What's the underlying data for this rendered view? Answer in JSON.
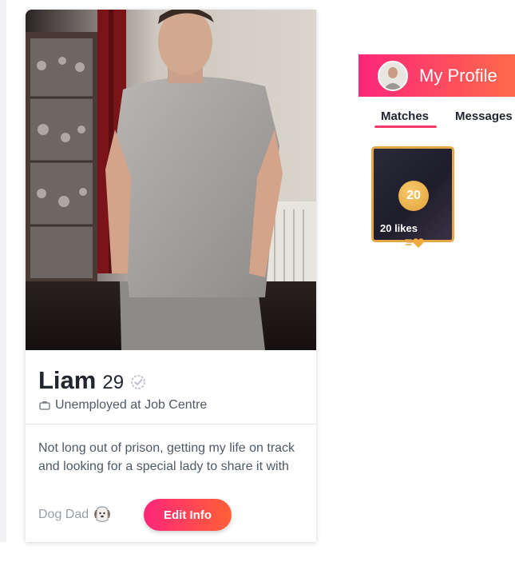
{
  "profile": {
    "name": "Liam",
    "age": "29",
    "job": "Unemployed at Job Centre",
    "bio": "Not long out of prison, getting my life on track and looking for a special lady to share it with",
    "badge": "Dog Dad",
    "edit_label": "Edit Info"
  },
  "header": {
    "title": "My Profile"
  },
  "tabs": [
    {
      "label": "Matches",
      "active": true
    },
    {
      "label": "Messages",
      "active": false
    }
  ],
  "likes": {
    "count": "20",
    "label": "20 likes"
  },
  "colors": {
    "accent": "#fd267a",
    "accent_end": "#ff6036",
    "gold": "#e5a54a",
    "text": "#21262e",
    "muted": "#505965"
  },
  "icons": [
    "verified-check-icon",
    "briefcase-icon",
    "dog-icon",
    "heart-icon"
  ]
}
